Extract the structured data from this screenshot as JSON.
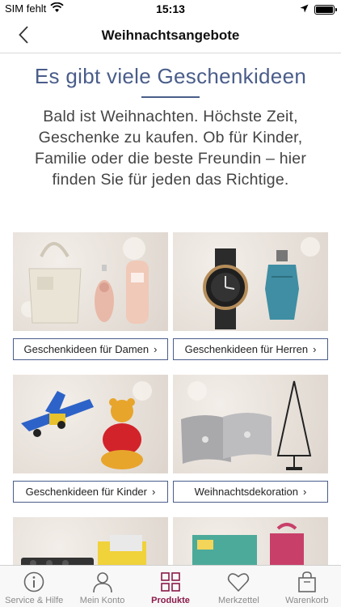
{
  "status_bar": {
    "carrier": "SIM fehlt",
    "time": "15:13"
  },
  "nav": {
    "title": "Weihnachtsangebote"
  },
  "main": {
    "headline": "Es gibt viele Geschenkideen",
    "intro": "Bald ist Weihnachten. Höchste Zeit, Geschenke zu kaufen. Ob für Kinder, Familie oder die beste Freundin – hier finden Sie für jeden das Richtige.",
    "tiles": [
      {
        "label": "Geschenkideen für Damen",
        "image": "handbag-and-perfume"
      },
      {
        "label": "Geschenkideen für Herren",
        "image": "watch-and-cologne"
      },
      {
        "label": "Geschenkideen für Kinder",
        "image": "toy-plane-and-teddy-bear"
      },
      {
        "label": "Weihnachtsdekoration",
        "image": "cushions-and-metal-tree"
      },
      {
        "label": "",
        "image": "baking-tray-and-gifts"
      },
      {
        "label": "",
        "image": "advent-calendars"
      }
    ]
  },
  "tab_bar": {
    "items": [
      {
        "label": "Service & Hilfe",
        "icon": "info-icon"
      },
      {
        "label": "Mein Konto",
        "icon": "person-icon"
      },
      {
        "label": "Produkte",
        "icon": "grid-icon",
        "active": true
      },
      {
        "label": "Merkzettel",
        "icon": "heart-icon"
      },
      {
        "label": "Warenkorb",
        "icon": "bag-icon"
      }
    ]
  },
  "colors": {
    "accent_blue": "#4a5d8a",
    "active_tab": "#8b1a4a"
  }
}
